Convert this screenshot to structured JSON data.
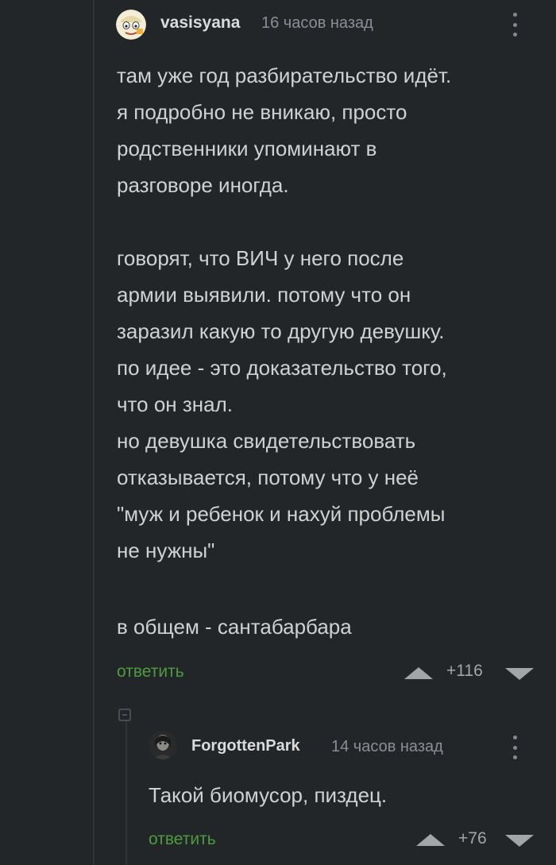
{
  "comments": [
    {
      "author": "vasisyana",
      "time": "16 часов назад",
      "paragraphs": [
        "там уже год разбирательство идёт.\nя подробно не вникаю, просто\nродственники упоминают в\nразговоре иногда.",
        "говорят, что ВИЧ у него после\nармии выявили. потому что он\nзаразил какую то другую девушку.\nпо идее - это доказательство того,\nчто он знал.\nно девушка свидетельствовать\nотказывается, потому что у неё\n\"муж и ребенок и нахуй проблемы\nне нужны\"",
        "в общем - сантабарбара"
      ],
      "reply_label": "ответить",
      "rating": "+116"
    },
    {
      "author": "ForgottenPark",
      "time": "14 часов назад",
      "paragraphs": [
        "Такой биомусор, пиздец."
      ],
      "reply_label": "ответить",
      "rating": "+76"
    }
  ],
  "icons": {
    "avatar_1": "cartoon-face-avatar",
    "avatar_2": "dark-portrait-avatar",
    "more": "vertical-ellipsis-icon",
    "upvote": "triangle-up-icon",
    "downvote": "triangle-down-icon",
    "collapse": "collapse-square-icon"
  },
  "colors": {
    "background": "#232629",
    "text": "#cfd1d2",
    "reply_link": "#4f9a3f",
    "muted": "#8b8f93"
  }
}
